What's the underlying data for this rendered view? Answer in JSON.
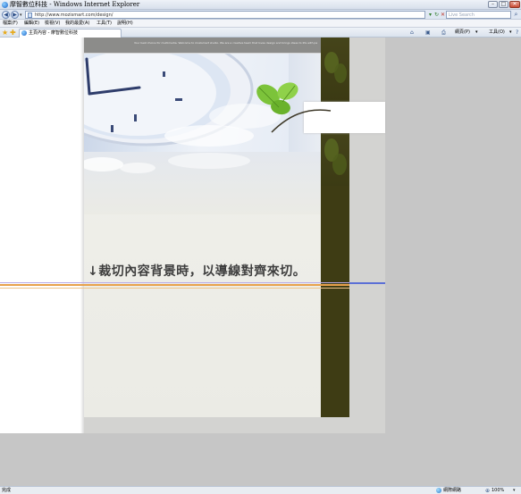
{
  "window": {
    "title": "摩智數位科技 - Windows Internet Explorer",
    "minimize": "–",
    "maximize": "□",
    "close": "✕"
  },
  "address_bar": {
    "url": "http://www.mozismart.com/design/",
    "search_placeholder": "Live Search",
    "back_symbol": "◀",
    "forward_symbol": "▶",
    "dropdown_symbol": "▾",
    "go_symbol": "▾",
    "refresh_symbol": "↻",
    "stop_symbol": "✕",
    "search_symbol": "⌕"
  },
  "menu": {
    "items": [
      "檔案(F)",
      "編輯(E)",
      "檢視(V)",
      "我的最愛(A)",
      "工具(T)",
      "說明(H)"
    ]
  },
  "toolbar": {
    "favorites_symbol": "★",
    "add_favorite_symbol": "✚",
    "tab_label": "主頁內容 - 摩智數位科技",
    "home_symbol": "⌂",
    "feeds_symbol": "▣",
    "print_symbol": "⎙",
    "page_label": "網頁(P)",
    "page_dd": "▾",
    "tools_label": "工具(O)",
    "tools_dd": "▾",
    "help_symbol": "?"
  },
  "page": {
    "header_tagline": "Your best choice for multimedia. Welcome to mozismart studio. We are a creative team that loves design and brings ideas to life with passion and care.",
    "crop_note": "↓裁切內容背景時，以導線對齊來切。"
  },
  "status": {
    "text": "完成",
    "zone": "網際網路",
    "zoom": "100%",
    "zoom_symbol": "⊕",
    "zoom_dd": "▾"
  },
  "colors": {
    "dark_band": "#3e3c14",
    "leaf_green": "#7cc33a",
    "guide_orange": "#e8a24c",
    "guide_blue": "#5b6fd6",
    "guide_lavender": "#b7a9e6"
  }
}
